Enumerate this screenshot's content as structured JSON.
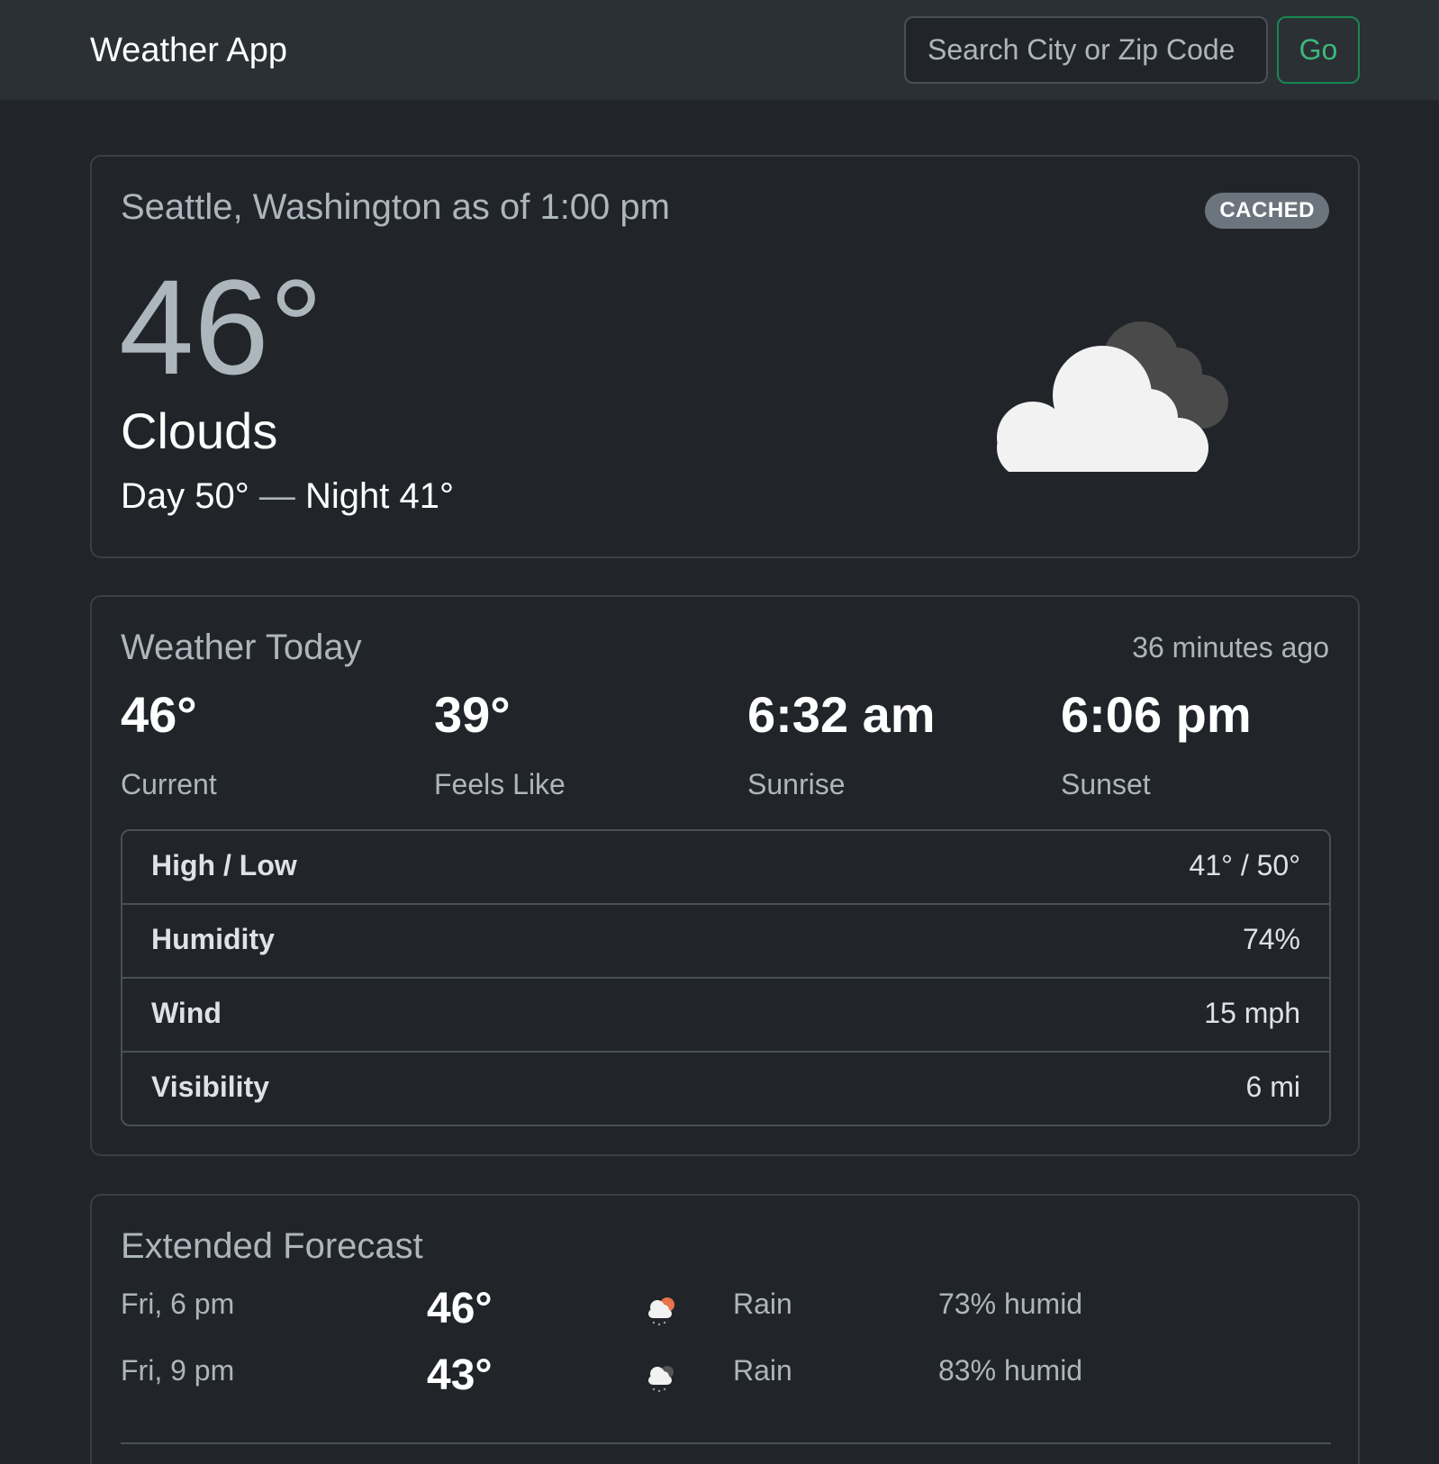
{
  "navbar": {
    "brand": "Weather App",
    "search_placeholder": "Search City or Zip Code",
    "go_label": "Go"
  },
  "current": {
    "title": "Seattle, Washington as of 1:00 pm",
    "badge": "CACHED",
    "temperature": "46°",
    "condition": "Clouds",
    "day": "Day 50°",
    "separator": "—",
    "night": "Night 41°",
    "icon": "cloud-icon"
  },
  "today": {
    "title": "Weather Today",
    "updated": "36 minutes ago",
    "stats": [
      {
        "value": "46°",
        "label": "Current"
      },
      {
        "value": "39°",
        "label": "Feels Like"
      },
      {
        "value": "6:32 am",
        "label": "Sunrise"
      },
      {
        "value": "6:06 pm",
        "label": "Sunset"
      }
    ],
    "details": [
      {
        "label": "High / Low",
        "value": "41° / 50°"
      },
      {
        "label": "Humidity",
        "value": "74%"
      },
      {
        "label": "Wind",
        "value": "15 mph"
      },
      {
        "label": "Visibility",
        "value": "6 mi"
      }
    ]
  },
  "forecast": {
    "title": "Extended Forecast",
    "rows": [
      {
        "time": "Fri, 6 pm",
        "temp": "46°",
        "icon": "rain-day-icon",
        "condition": "Rain",
        "humidity": "73% humid"
      },
      {
        "time": "Fri, 9 pm",
        "temp": "43°",
        "icon": "rain-night-icon",
        "condition": "Rain",
        "humidity": "83% humid"
      }
    ]
  },
  "colors": {
    "background": "#212529",
    "navbar": "#2b3035",
    "accent_go": "#198754",
    "badge": "#6c757d",
    "muted_text": "#adb5bd"
  }
}
